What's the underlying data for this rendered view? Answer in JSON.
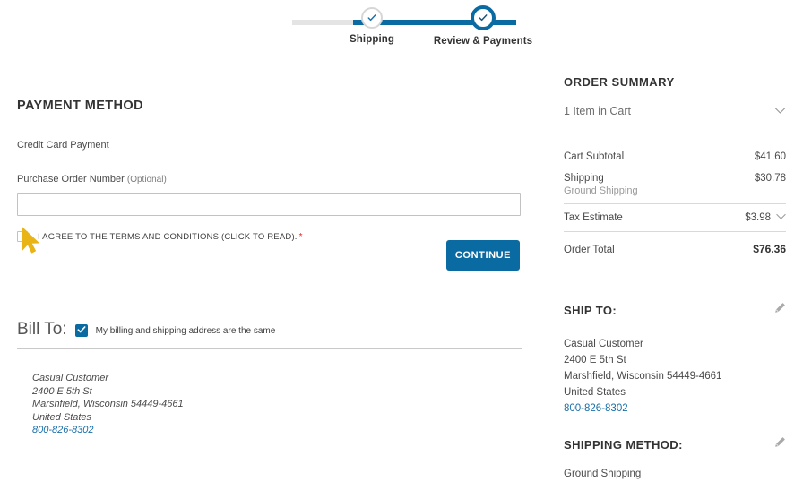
{
  "progress": {
    "steps": [
      {
        "label": "Shipping",
        "state": "done"
      },
      {
        "label": "Review & Payments",
        "state": "current"
      }
    ],
    "active_color": "#0a6ba2",
    "inactive_color": "#e4e4e4"
  },
  "payment": {
    "heading": "PAYMENT METHOD",
    "method_name": "Credit Card Payment",
    "po_label": "Purchase Order Number",
    "po_optional": "(Optional)",
    "po_value": "",
    "po_placeholder": "",
    "agree_text": "I AGREE TO THE TERMS AND CONDITIONS (CLICK TO READ).",
    "required_marker": "*",
    "agree_checked": false,
    "continue_label": "CONTINUE",
    "continue_color": "#0a6ba2"
  },
  "bill_to": {
    "title": "Bill To:",
    "same_as_shipping_label": "My billing and shipping address are the same",
    "same_as_shipping_checked": true,
    "address": {
      "name": "Casual Customer",
      "street": "2400 E 5th St",
      "city_state_zip": "Marshfield, Wisconsin 54449-4661",
      "country": "United States",
      "phone": "800-826-8302"
    }
  },
  "order_summary": {
    "heading": "ORDER SUMMARY",
    "cart_items_label": "1 Item in Cart",
    "rows": [
      {
        "label": "Cart Subtotal",
        "value": "$41.60",
        "sub": "",
        "chevron": false
      },
      {
        "label": "Shipping",
        "value": "$30.78",
        "sub": "Ground Shipping",
        "chevron": false
      },
      {
        "label": "Tax Estimate",
        "value": "$3.98",
        "sub": "",
        "chevron": true
      }
    ],
    "total_label": "Order Total",
    "total_value": "$76.36"
  },
  "ship_to": {
    "heading": "SHIP TO:",
    "edit_icon": "pencil-icon",
    "address": {
      "name": "Casual Customer",
      "street": "2400 E 5th St",
      "city_state_zip": "Marshfield, Wisconsin 54449-4661",
      "country": "United States",
      "phone": "800-826-8302"
    }
  },
  "shipping_method": {
    "heading": "SHIPPING METHOD:",
    "edit_icon": "pencil-icon",
    "value": "Ground Shipping"
  },
  "cursor": {
    "type": "arrow-pointer",
    "color": "#e8b416"
  }
}
